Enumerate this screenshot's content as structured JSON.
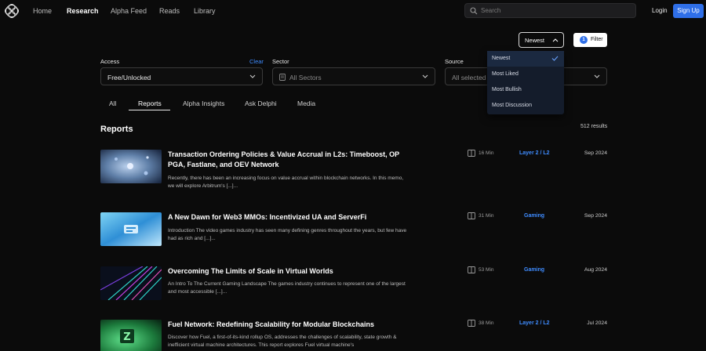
{
  "nav": {
    "links": [
      "Home",
      "Research",
      "Alpha Feed",
      "Reads",
      "Library"
    ],
    "active": "Research",
    "search_placeholder": "Search",
    "login": "Login",
    "signup": "Sign Up"
  },
  "sort": {
    "selected": "Newest",
    "options": [
      "Newest",
      "Most Liked",
      "Most Bullish",
      "Most Discussion"
    ]
  },
  "filter": {
    "count": "1",
    "label": "Filter"
  },
  "filters": {
    "access_label": "Access",
    "clear_label": "Clear",
    "access_value": "Free/Unlocked",
    "sector_label": "Sector",
    "sector_value": "All Sectors",
    "source_label": "Source",
    "source_value": "All selected"
  },
  "tabs": [
    "All",
    "Reports",
    "Alpha Insights",
    "Ask Delphi",
    "Media"
  ],
  "active_tab": "Reports",
  "section": {
    "title": "Reports",
    "results": "512 results"
  },
  "reports": [
    {
      "title": "Transaction Ordering Policies & Value Accrual in L2s: Timeboost, OP PGA, Fastlane, and OEV Network",
      "description": "Recently, there has been an increasing focus on value accrual within blockchain networks. In this memo, we will explore Arbitrum's [...]...",
      "read_time": "16 Min",
      "sector": "Layer 2 / L2",
      "date": "Sep 2024"
    },
    {
      "title": "A New Dawn for Web3 MMOs: Incentivized UA and ServerFi",
      "description": "Introduction The video games industry has seen many defining genres throughout the years, but few have had as rich and [...]...",
      "read_time": "31 Min",
      "sector": "Gaming",
      "date": "Sep 2024"
    },
    {
      "title": "Overcoming The Limits of Scale in Virtual Worlds",
      "description": "An Intro To The Current Gaming Landscape The games industry continues to represent one of the largest and most accessible [...]...",
      "read_time": "53 Min",
      "sector": "Gaming",
      "date": "Aug 2024"
    },
    {
      "title": "Fuel Network: Redefining Scalability for Modular Blockchains",
      "description": "Discover how Fuel, a first-of-its-kind rollup OS, addresses the challenges of scalability, state growth & inefficient virtual machine architectures. This report explores Fuel virtual machine's",
      "read_time": "38 Min",
      "sector": "Layer 2 / L2",
      "date": "Jul 2024"
    }
  ]
}
